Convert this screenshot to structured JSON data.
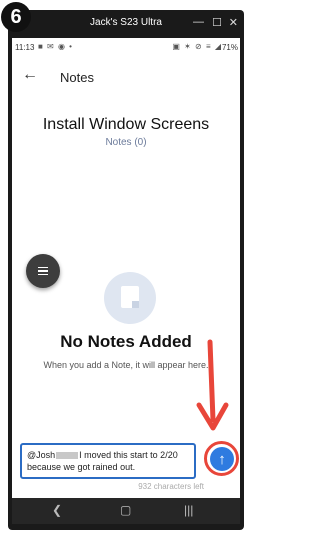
{
  "step_number": "6",
  "window": {
    "title": "Jack's S23 Ultra",
    "pin_icon": "pin-icon",
    "minimize": "—",
    "maximize": "☐",
    "close": "✕"
  },
  "status_bar": {
    "time": "11:13",
    "left_icons": "■ ✉ ◉ •",
    "right_icons": "▣ ✶ ⊘ ≡ ◢",
    "battery": "71%"
  },
  "app_bar": {
    "back_glyph": "←",
    "title": "Notes"
  },
  "task": {
    "title": "Install Window Screens",
    "notes_count": "Notes (0)"
  },
  "empty_state": {
    "title": "No Notes Added",
    "description": "When you add a Note, it will appear here."
  },
  "composer": {
    "mention": "@Josh",
    "text": "I moved this start to 2/20 because we got rained out.",
    "chars_left": "932 characters left",
    "send_glyph": "↑"
  },
  "nav_bar": {
    "recents": "|||",
    "home": "▢",
    "back": "❮"
  },
  "colors": {
    "accent": "#2f7be0",
    "annotation": "#e8463a",
    "fab": "#3d3d3d"
  }
}
